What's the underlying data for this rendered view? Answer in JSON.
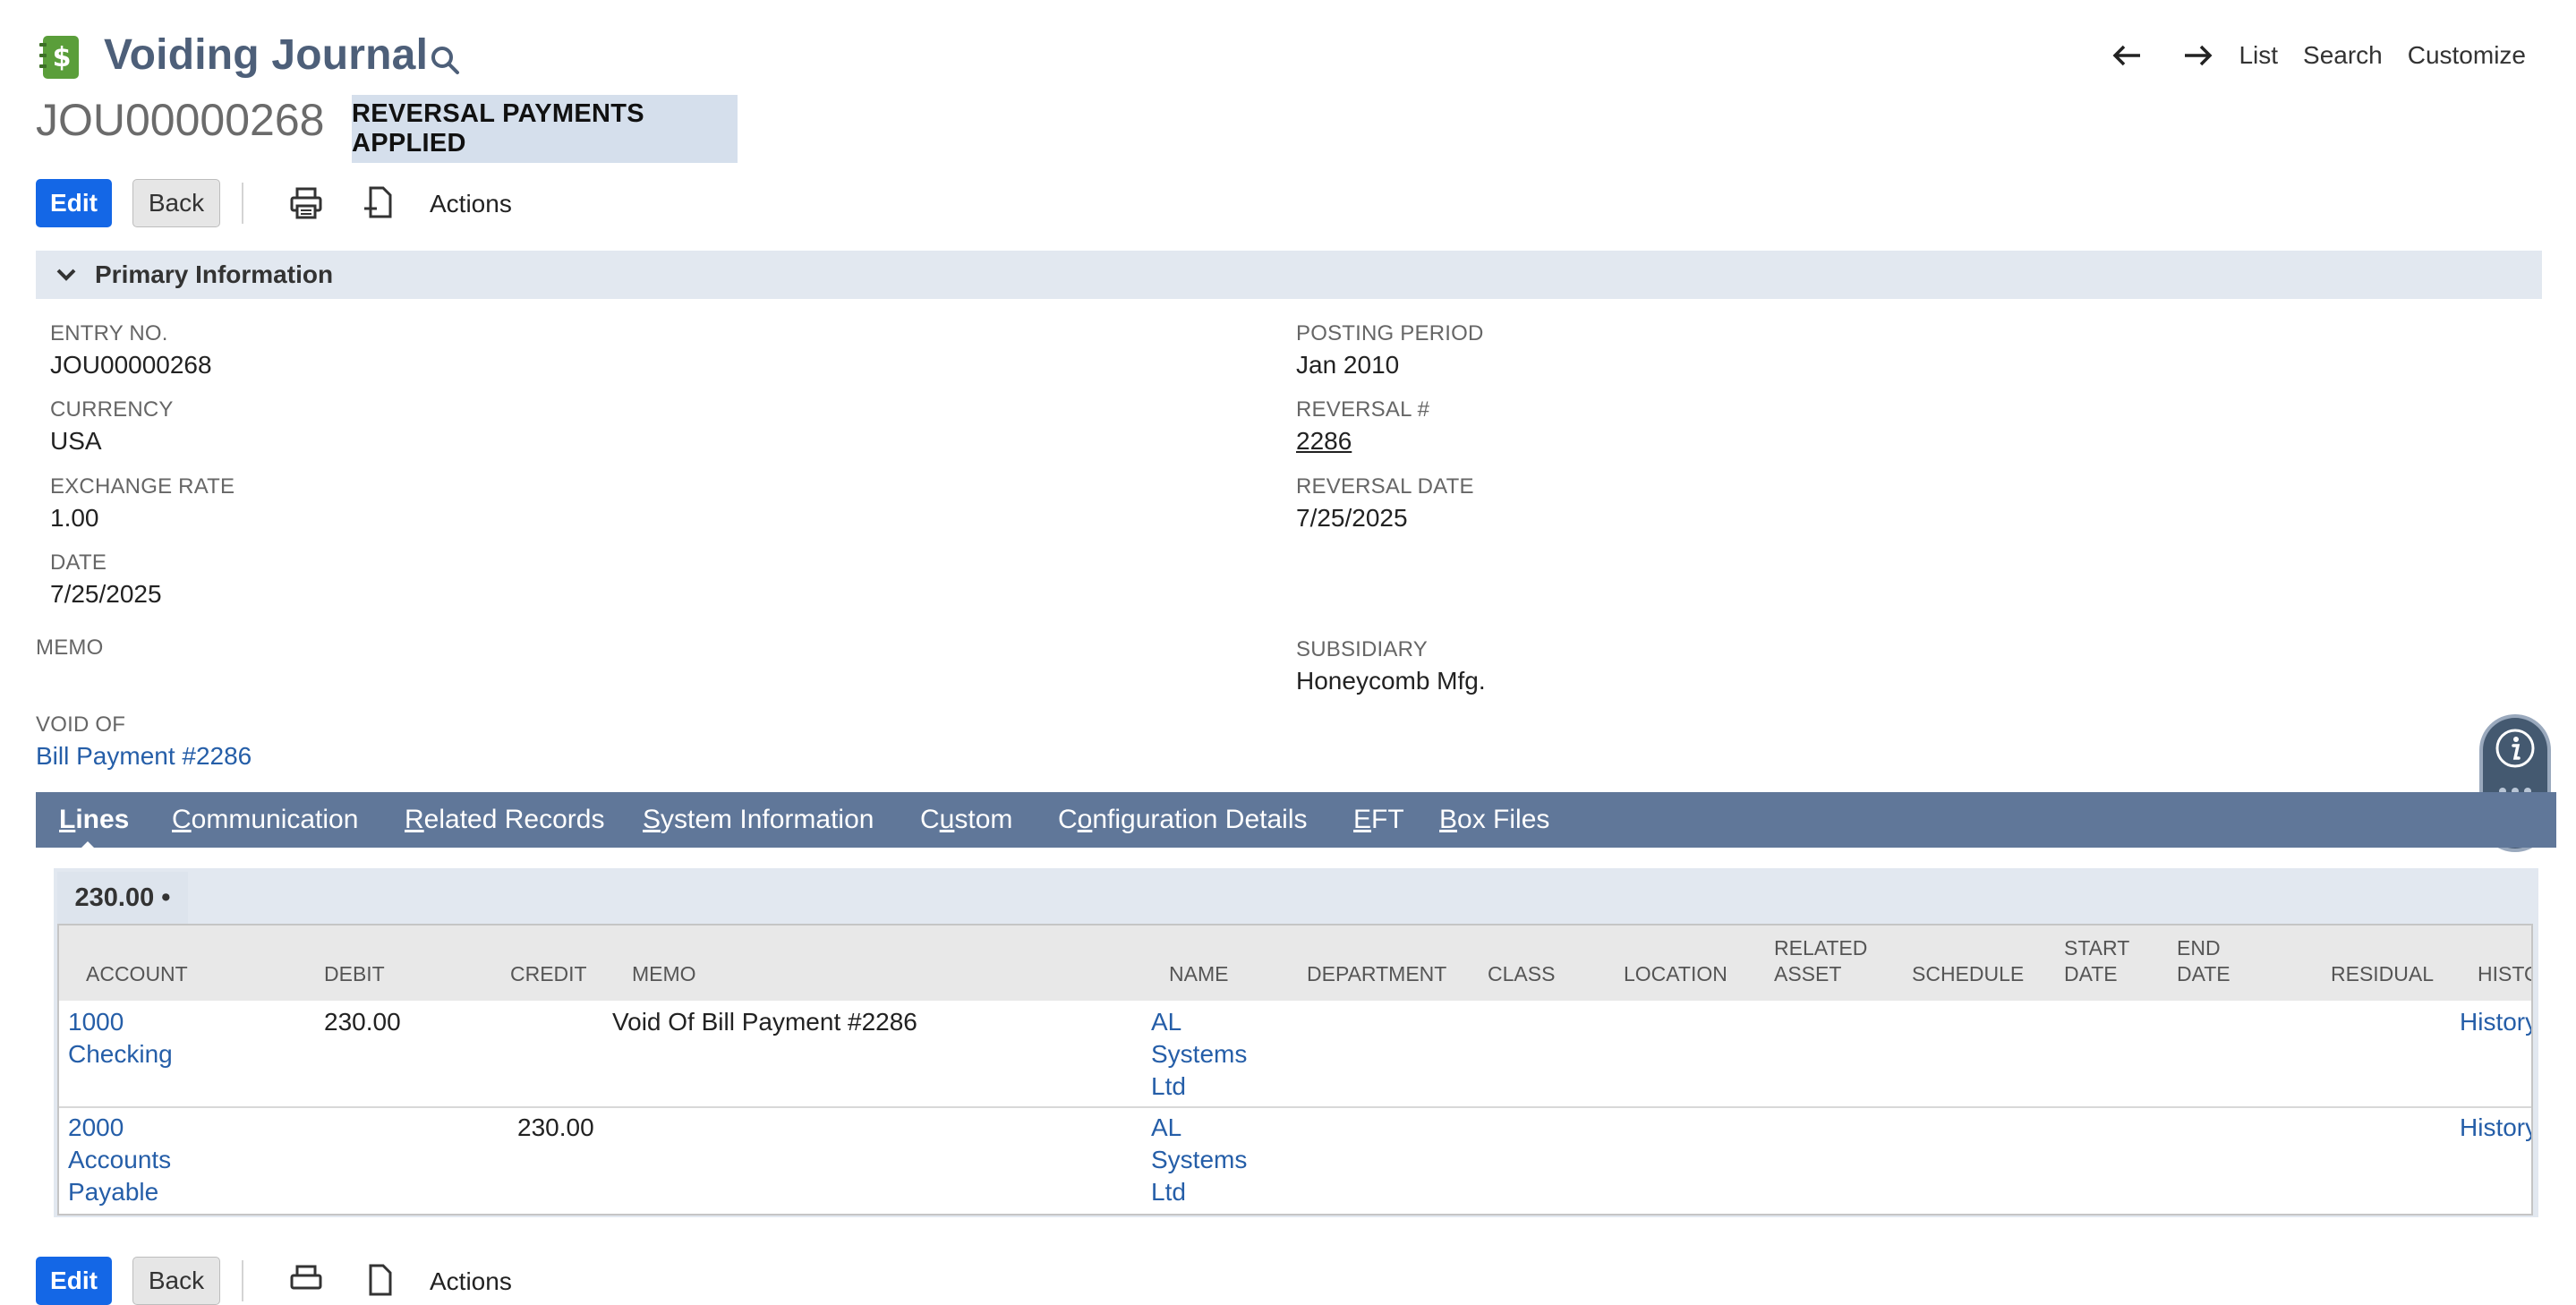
{
  "header": {
    "title": "Voiding Journal",
    "entry_id": "JOU00000268",
    "status": "REVERSAL PAYMENTS APPLIED",
    "nav": {
      "list": "List",
      "search": "Search",
      "customize": "Customize"
    }
  },
  "toolbar": {
    "edit": "Edit",
    "back": "Back",
    "actions": "Actions"
  },
  "section": {
    "title": "Primary Information"
  },
  "fields": {
    "entry_no": {
      "label": "ENTRY NO.",
      "value": "JOU00000268"
    },
    "currency": {
      "label": "CURRENCY",
      "value": "USA"
    },
    "exchange_rate": {
      "label": "EXCHANGE RATE",
      "value": "1.00"
    },
    "date": {
      "label": "DATE",
      "value": "7/25/2025"
    },
    "memo": {
      "label": "MEMO",
      "value": ""
    },
    "void_of": {
      "label": "VOID OF",
      "value": "Bill Payment #2286"
    },
    "posting_period": {
      "label": "POSTING PERIOD",
      "value": "Jan 2010"
    },
    "reversal_no": {
      "label": "REVERSAL #",
      "value": "2286"
    },
    "reversal_date": {
      "label": "REVERSAL DATE",
      "value": "7/25/2025"
    },
    "subsidiary": {
      "label": "SUBSIDIARY",
      "value": "Honeycomb Mfg."
    }
  },
  "tabs": [
    {
      "pre": "",
      "u": "L",
      "post": "ines"
    },
    {
      "pre": "",
      "u": "C",
      "post": "ommunication"
    },
    {
      "pre": "",
      "u": "R",
      "post": "elated Records"
    },
    {
      "pre": "",
      "u": "S",
      "post": "ystem Information"
    },
    {
      "pre": "C",
      "u": "u",
      "post": "stom"
    },
    {
      "pre": "C",
      "u": "o",
      "post": "nfiguration Details"
    },
    {
      "pre": "",
      "u": "E",
      "post": "FT"
    },
    {
      "pre": "",
      "u": "B",
      "post": "ox Files"
    }
  ],
  "lines": {
    "subtotal": "230.00 •",
    "columns": [
      "ACCOUNT",
      "DEBIT",
      "CREDIT",
      "MEMO",
      "NAME",
      "DEPARTMENT",
      "CLASS",
      "LOCATION",
      "RELATED\nASSET",
      "SCHEDULE",
      "START\nDATE",
      "END\nDATE",
      "RESIDUAL",
      "HISTORY"
    ],
    "rows": [
      {
        "account": "1000\nChecking",
        "debit": "230.00",
        "credit": "",
        "memo": "Void Of Bill Payment #2286",
        "name": "AL\nSystems\nLtd",
        "history": "History"
      },
      {
        "account": "2000\nAccounts\nPayable",
        "debit": "",
        "credit": "230.00",
        "memo": "",
        "name": "AL\nSystems\nLtd",
        "history": "History"
      }
    ]
  },
  "colors": {
    "accent": "#1467e6",
    "tabbar": "#607799",
    "link": "#255ea8",
    "badge": "#d5dfec"
  }
}
